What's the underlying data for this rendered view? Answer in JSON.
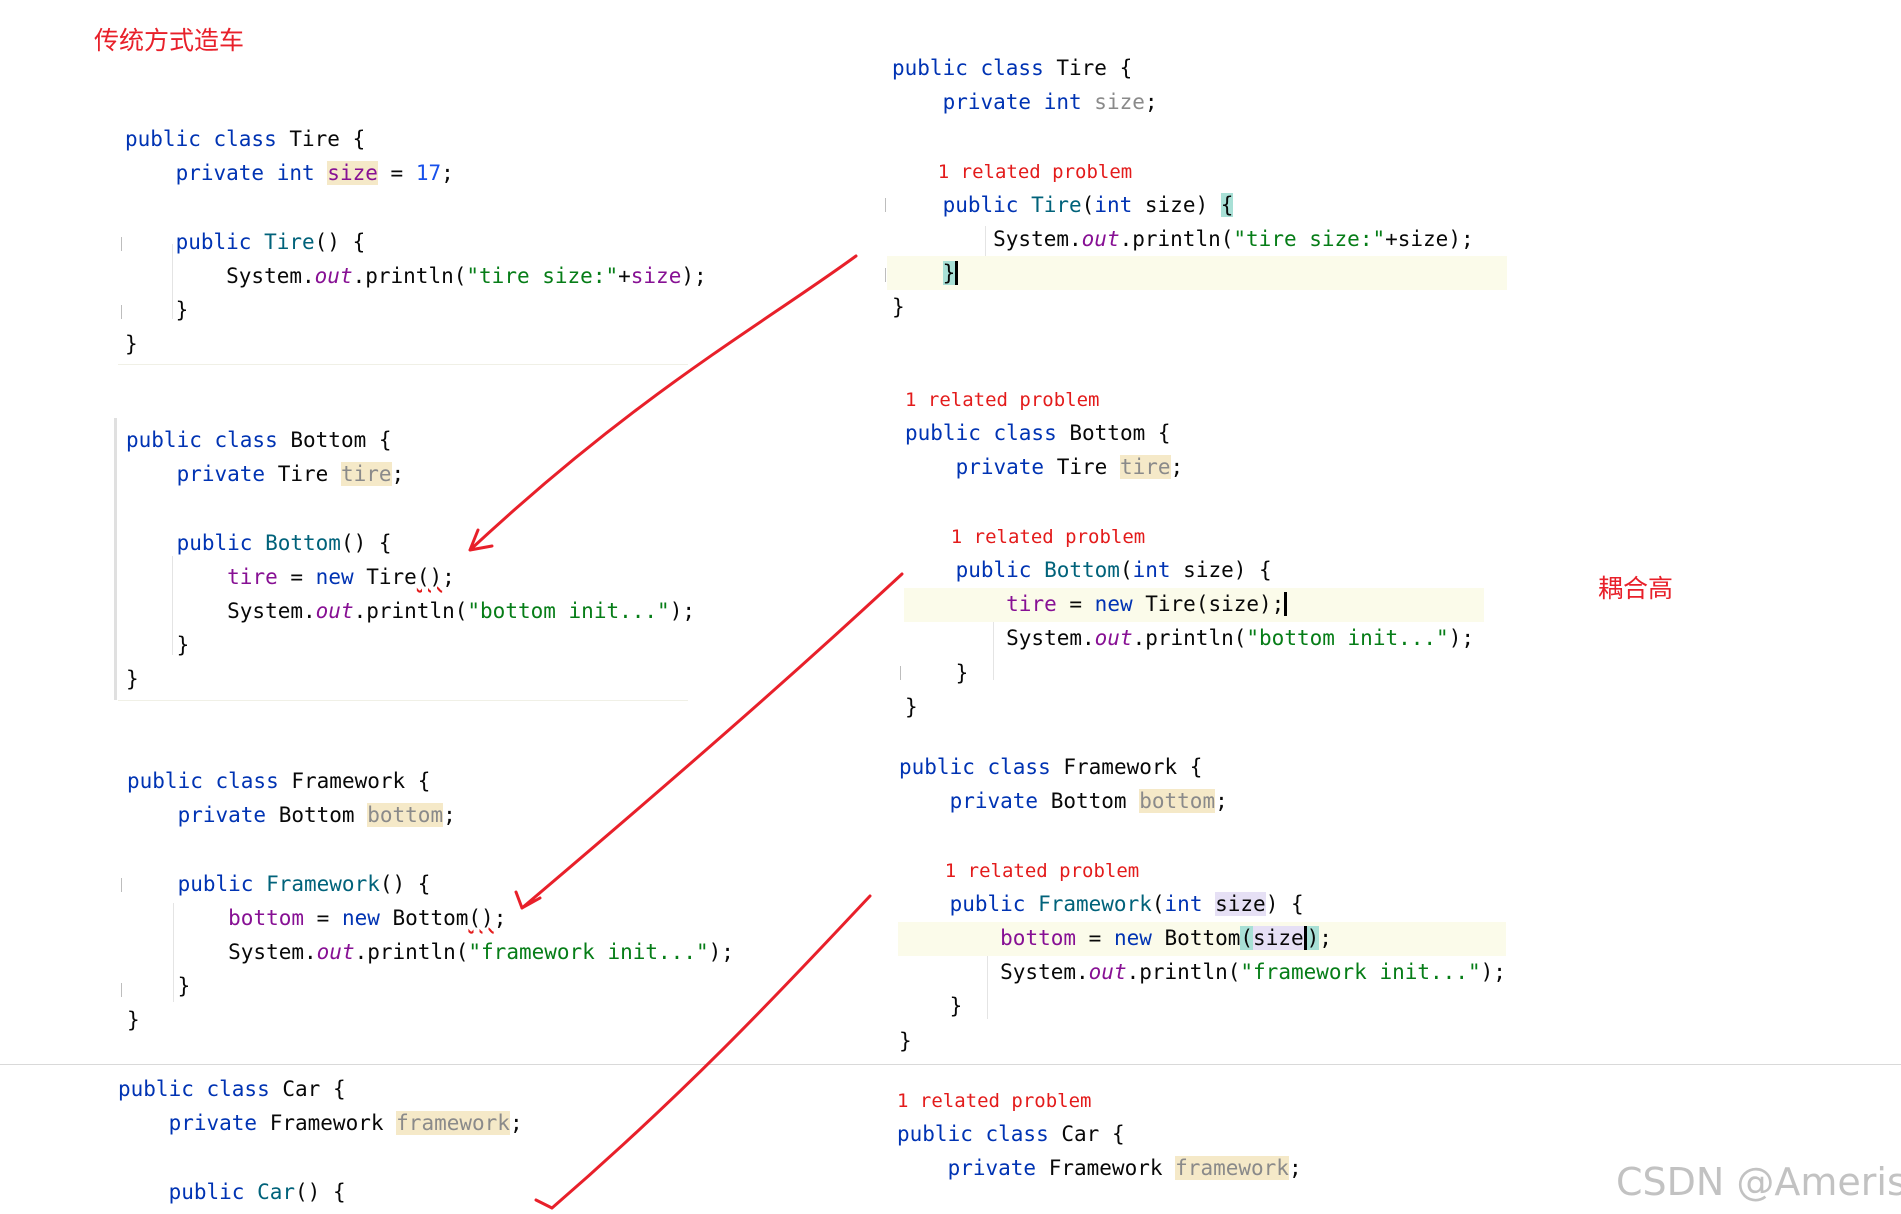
{
  "left_title": "传统方式造车",
  "right_note": "耦合高",
  "watermark": "CSDN @Ameris Z",
  "code_colors": {
    "keyword": "#0033b3",
    "string": "#067d17",
    "number": "#1750eb",
    "field": "#871094",
    "method": "#00627a",
    "problem": "#e31b1b",
    "arrow": "#e8202a"
  },
  "left": {
    "tire": [
      [
        [
          "public class ",
          "kw"
        ],
        [
          "Tire {",
          "id"
        ]
      ],
      [
        [
          "    private int ",
          "kw"
        ],
        [
          "size",
          "fld fhl"
        ],
        [
          " = ",
          "id"
        ],
        [
          "17",
          "num"
        ],
        [
          ";",
          "id"
        ]
      ],
      [],
      [
        [
          "    public ",
          "kw"
        ],
        [
          "Tire",
          "meth"
        ],
        [
          "() {",
          "id"
        ]
      ],
      [
        [
          "        System.",
          "id"
        ],
        [
          "out",
          "stat"
        ],
        [
          ".println(",
          "id"
        ],
        [
          "\"tire size:\"",
          "str"
        ],
        [
          "+",
          "id"
        ],
        [
          "size",
          "fld"
        ],
        [
          ");",
          "id"
        ]
      ],
      [
        [
          "    }",
          "id"
        ]
      ],
      [
        [
          "}",
          "id"
        ]
      ]
    ],
    "bottom": [
      [
        [
          "public class ",
          "kw"
        ],
        [
          "Bottom {",
          "id"
        ]
      ],
      [
        [
          "    private ",
          "kw"
        ],
        [
          "Tire ",
          "id"
        ],
        [
          "tire",
          "fldu fhl"
        ],
        [
          ";",
          "id"
        ]
      ],
      [],
      [
        [
          "    public ",
          "kw"
        ],
        [
          "Bottom",
          "meth"
        ],
        [
          "() {",
          "id"
        ]
      ],
      [
        [
          "        ",
          "id"
        ],
        [
          "tire",
          "fld"
        ],
        [
          " = ",
          "id"
        ],
        [
          "new ",
          "kw"
        ],
        [
          "Tire",
          "id"
        ],
        [
          "()",
          "id squig"
        ],
        [
          ";",
          "id"
        ]
      ],
      [
        [
          "        System.",
          "id"
        ],
        [
          "out",
          "stat"
        ],
        [
          ".println(",
          "id"
        ],
        [
          "\"bottom init...\"",
          "str"
        ],
        [
          ");",
          "id"
        ]
      ],
      [
        [
          "    }",
          "id"
        ]
      ],
      [
        [
          "}",
          "id"
        ]
      ]
    ],
    "framework": [
      [
        [
          "public class ",
          "kw"
        ],
        [
          "Framework {",
          "id"
        ]
      ],
      [
        [
          "    private ",
          "kw"
        ],
        [
          "Bottom ",
          "id"
        ],
        [
          "bottom",
          "fldu fhl"
        ],
        [
          ";",
          "id"
        ]
      ],
      [],
      [
        [
          "    public ",
          "kw"
        ],
        [
          "Framework",
          "meth"
        ],
        [
          "() {",
          "id"
        ]
      ],
      [
        [
          "        ",
          "id"
        ],
        [
          "bottom",
          "fld"
        ],
        [
          " = ",
          "id"
        ],
        [
          "new ",
          "kw"
        ],
        [
          "Bottom",
          "id"
        ],
        [
          "()",
          "id squig"
        ],
        [
          ";",
          "id"
        ]
      ],
      [
        [
          "        System.",
          "id"
        ],
        [
          "out",
          "stat"
        ],
        [
          ".println(",
          "id"
        ],
        [
          "\"framework init...\"",
          "str"
        ],
        [
          ");",
          "id"
        ]
      ],
      [
        [
          "    }",
          "id"
        ]
      ],
      [
        [
          "}",
          "id"
        ]
      ]
    ],
    "car": [
      [
        [
          "public class ",
          "kw"
        ],
        [
          "Car {",
          "id"
        ]
      ],
      [
        [
          "    private ",
          "kw"
        ],
        [
          "Framework ",
          "id"
        ],
        [
          "framework",
          "fldu fhl"
        ],
        [
          ";",
          "id"
        ]
      ],
      [],
      [
        [
          "    public ",
          "kw"
        ],
        [
          "Car",
          "meth"
        ],
        [
          "() {",
          "id"
        ]
      ]
    ]
  },
  "right": {
    "tire": [
      [
        [
          "public class ",
          "kw"
        ],
        [
          "Tire {",
          "id"
        ]
      ],
      [
        [
          "    private int ",
          "kw"
        ],
        [
          "size",
          "fldu"
        ],
        [
          ";",
          "id"
        ]
      ],
      [],
      [
        [
          "    1 related problem",
          "prob"
        ]
      ],
      [
        [
          "    public ",
          "kw"
        ],
        [
          "Tire",
          "meth"
        ],
        [
          "(",
          "id"
        ],
        [
          "int ",
          "kw"
        ],
        [
          "size) ",
          "id"
        ],
        [
          "{",
          "id thl"
        ]
      ],
      [
        [
          "        System.",
          "id"
        ],
        [
          "out",
          "stat"
        ],
        [
          ".println(",
          "id"
        ],
        [
          "\"tire size:\"",
          "str"
        ],
        [
          "+size);",
          "id"
        ]
      ],
      [
        [
          "    ",
          "id"
        ],
        [
          "}",
          "id thl caret"
        ]
      ],
      [
        [
          "}",
          "id"
        ]
      ]
    ],
    "bottom": [
      [
        [
          "1 related problem",
          "prob"
        ]
      ],
      [
        [
          "public class ",
          "kw"
        ],
        [
          "Bottom {",
          "id"
        ]
      ],
      [
        [
          "    private ",
          "kw"
        ],
        [
          "Tire ",
          "id"
        ],
        [
          "tire",
          "fldu fhl"
        ],
        [
          ";",
          "id"
        ]
      ],
      [],
      [
        [
          "    1 related problem",
          "prob"
        ]
      ],
      [
        [
          "    public ",
          "kw"
        ],
        [
          "Bottom",
          "meth"
        ],
        [
          "(",
          "id"
        ],
        [
          "int ",
          "kw"
        ],
        [
          "size) {",
          "id"
        ]
      ],
      [
        [
          "        ",
          "id"
        ],
        [
          "tire",
          "fld"
        ],
        [
          " = ",
          "id"
        ],
        [
          "new ",
          "kw"
        ],
        [
          "Tire(size);",
          "id caret"
        ]
      ],
      [
        [
          "        System.",
          "id"
        ],
        [
          "out",
          "stat"
        ],
        [
          ".println(",
          "id"
        ],
        [
          "\"bottom init...\"",
          "str"
        ],
        [
          ");",
          "id"
        ]
      ],
      [
        [
          "    }",
          "id"
        ]
      ],
      [
        [
          "}",
          "id"
        ]
      ]
    ],
    "framework": [
      [
        [
          "public class ",
          "kw"
        ],
        [
          "Framework {",
          "id"
        ]
      ],
      [
        [
          "    private ",
          "kw"
        ],
        [
          "Bottom ",
          "id"
        ],
        [
          "bottom",
          "fldu fhl"
        ],
        [
          ";",
          "id"
        ]
      ],
      [],
      [
        [
          "    1 related problem",
          "prob"
        ]
      ],
      [
        [
          "    public ",
          "kw"
        ],
        [
          "Framework",
          "meth"
        ],
        [
          "(",
          "id"
        ],
        [
          "int ",
          "kw"
        ],
        [
          "size",
          "id phl"
        ],
        [
          ") {",
          "id"
        ]
      ],
      [
        [
          "        ",
          "id"
        ],
        [
          "bottom",
          "fld"
        ],
        [
          " = ",
          "id"
        ],
        [
          "new ",
          "kw"
        ],
        [
          "Bottom",
          "id"
        ],
        [
          "(",
          "id thl"
        ],
        [
          "size",
          "id phl caret"
        ],
        [
          ")",
          "id thl"
        ],
        [
          ";",
          "id"
        ]
      ],
      [
        [
          "        System.",
          "id"
        ],
        [
          "out",
          "stat"
        ],
        [
          ".println(",
          "id"
        ],
        [
          "\"framework init...\"",
          "str"
        ],
        [
          ");",
          "id"
        ]
      ],
      [
        [
          "    }",
          "id"
        ]
      ],
      [
        [
          "}",
          "id"
        ]
      ]
    ],
    "car": [
      [
        [
          "1 related problem",
          "prob"
        ]
      ],
      [
        [
          "public class ",
          "kw"
        ],
        [
          "Car {",
          "id"
        ]
      ],
      [
        [
          "    private ",
          "kw"
        ],
        [
          "Framework ",
          "id"
        ],
        [
          "framework",
          "fldu fhl"
        ],
        [
          ";",
          "id"
        ]
      ]
    ]
  }
}
